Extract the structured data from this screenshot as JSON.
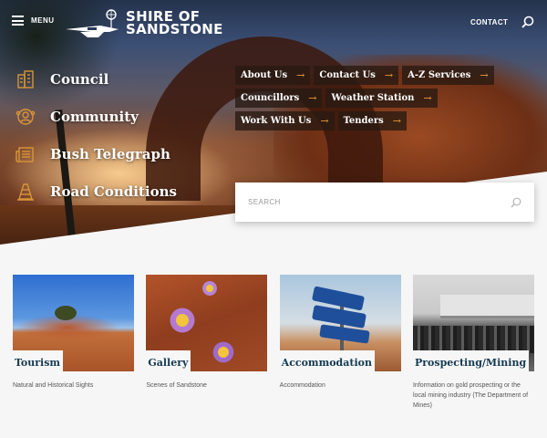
{
  "header": {
    "menu_label": "MENU",
    "logo_line1": "SHIRE OF",
    "logo_line2": "SANDSTONE",
    "contact_label": "CONTACT"
  },
  "main_nav": [
    {
      "label": "Council",
      "icon": "building-icon"
    },
    {
      "label": "Community",
      "icon": "community-icon"
    },
    {
      "label": "Bush Telegraph",
      "icon": "newspaper-icon"
    },
    {
      "label": "Road Conditions",
      "icon": "traffic-cone-icon"
    }
  ],
  "quick_links": [
    {
      "label": "About Us"
    },
    {
      "label": "Contact Us"
    },
    {
      "label": "A-Z Services"
    },
    {
      "label": "Councillors"
    },
    {
      "label": "Weather Station"
    },
    {
      "label": "Work With Us"
    },
    {
      "label": "Tenders"
    }
  ],
  "quick_link_arrow": "→",
  "search": {
    "placeholder": "SEARCH"
  },
  "cards": [
    {
      "title": "Tourism",
      "desc": "Natural and Historical Sights"
    },
    {
      "title": "Gallery",
      "desc": "Scenes of Sandstone"
    },
    {
      "title": "Accommodation",
      "desc": "Accommodation"
    },
    {
      "title": "Prospecting/Mining",
      "desc": "Information on gold prospecting or the local mining industry (The Department of Mines)"
    }
  ],
  "colors": {
    "accent": "#e79b3a",
    "card_title": "#153a52",
    "icon": "#d99536"
  }
}
